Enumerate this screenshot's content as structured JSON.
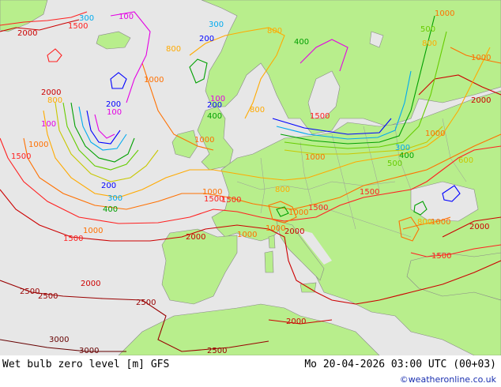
{
  "footer": {
    "title": "Wet bulb zero level [m] GFS",
    "datetime": "Mo 20-04-2026 03:00 UTC (00+03)",
    "credit": "©weatheronline.co.uk"
  },
  "colors": {
    "sea": "#e7e7e7",
    "land": "#b8ee8c",
    "c100": "#e400e4",
    "c200": "#0000ff",
    "c300": "#00aaee",
    "c400": "#00a000",
    "c500": "#66cc00",
    "c600": "#c8c800",
    "c800": "#ffaa00",
    "c1000": "#ff7000",
    "c1500": "#ff2020",
    "c2000": "#cc0000",
    "c2500": "#990000",
    "c3000": "#660000"
  },
  "contour_labels": [
    {
      "text": "2000",
      "color": "c2000"
    },
    {
      "text": "1500",
      "color": "c1500"
    },
    {
      "text": "2000",
      "color": "c2000"
    },
    {
      "text": "1500",
      "color": "c1500"
    },
    {
      "text": "1000",
      "color": "c1000"
    },
    {
      "text": "800",
      "color": "c800"
    },
    {
      "text": "100",
      "color": "c100"
    },
    {
      "text": "200",
      "color": "c200"
    },
    {
      "text": "100",
      "color": "c100"
    },
    {
      "text": "1000",
      "color": "c1000"
    },
    {
      "text": "200",
      "color": "c200"
    },
    {
      "text": "300",
      "color": "c300"
    },
    {
      "text": "400",
      "color": "c400"
    },
    {
      "text": "1000",
      "color": "c1000"
    },
    {
      "text": "1500",
      "color": "c1500"
    },
    {
      "text": "1500",
      "color": "c1500"
    },
    {
      "text": "2000",
      "color": "c2000"
    },
    {
      "text": "2500",
      "color": "c2500"
    },
    {
      "text": "2500",
      "color": "c2500"
    },
    {
      "text": "3000",
      "color": "c3000"
    },
    {
      "text": "3000",
      "color": "c3000"
    },
    {
      "text": "2500",
      "color": "c2500"
    },
    {
      "text": "2500",
      "color": "c2500"
    },
    {
      "text": "2000",
      "color": "c2000"
    },
    {
      "text": "2000",
      "color": "c2000"
    },
    {
      "text": "2000",
      "color": "c2000"
    },
    {
      "text": "1500",
      "color": "c1500"
    },
    {
      "text": "1500",
      "color": "c1500"
    },
    {
      "text": "1500",
      "color": "c1500"
    },
    {
      "text": "1000",
      "color": "c1000"
    },
    {
      "text": "1000",
      "color": "c1000"
    },
    {
      "text": "1000",
      "color": "c1000"
    },
    {
      "text": "1000",
      "color": "c1000"
    },
    {
      "text": "1000",
      "color": "c1000"
    },
    {
      "text": "800",
      "color": "c800"
    },
    {
      "text": "800",
      "color": "c800"
    },
    {
      "text": "800",
      "color": "c800"
    },
    {
      "text": "800",
      "color": "c800"
    },
    {
      "text": "600",
      "color": "c600"
    },
    {
      "text": "500",
      "color": "c500"
    },
    {
      "text": "400",
      "color": "c400"
    },
    {
      "text": "300",
      "color": "c300"
    },
    {
      "text": "200",
      "color": "c200"
    },
    {
      "text": "100",
      "color": "c100"
    },
    {
      "text": "400",
      "color": "c400"
    },
    {
      "text": "300",
      "color": "c300"
    },
    {
      "text": "200",
      "color": "c200"
    },
    {
      "text": "100",
      "color": "c100"
    },
    {
      "text": "1000",
      "color": "c1000"
    },
    {
      "text": "800",
      "color": "c800"
    },
    {
      "text": "1000",
      "color": "c1000"
    },
    {
      "text": "2000",
      "color": "c2000"
    },
    {
      "text": "1500",
      "color": "c1500"
    },
    {
      "text": "2000",
      "color": "c2000"
    },
    {
      "text": "1000",
      "color": "c1000"
    },
    {
      "text": "500",
      "color": "c500"
    },
    {
      "text": "1500",
      "color": "c1500"
    },
    {
      "text": "1000",
      "color": "c1000"
    },
    {
      "text": "400",
      "color": "c400"
    },
    {
      "text": "800",
      "color": "c800"
    },
    {
      "text": "1000",
      "color": "c1000"
    },
    {
      "text": "300",
      "color": "c300"
    }
  ]
}
